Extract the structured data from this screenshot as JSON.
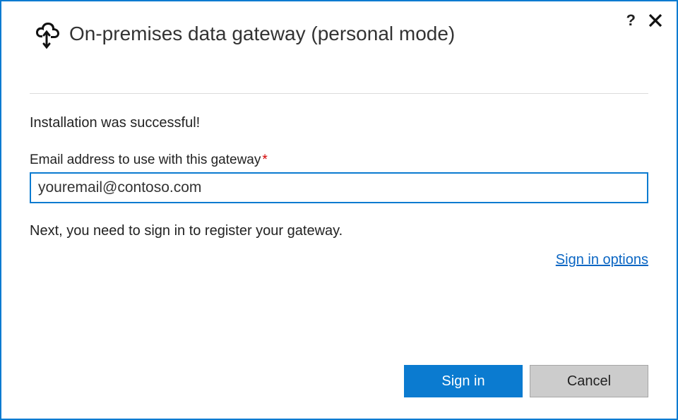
{
  "header": {
    "title": "On-premises data gateway (personal mode)"
  },
  "body": {
    "success_message": "Installation was successful!",
    "email_label": "Email address to use with this gateway",
    "email_value": "youremail@contoso.com",
    "hint": "Next, you need to sign in to register your gateway.",
    "options_link": "Sign in options"
  },
  "buttons": {
    "primary": "Sign in",
    "secondary": "Cancel"
  }
}
